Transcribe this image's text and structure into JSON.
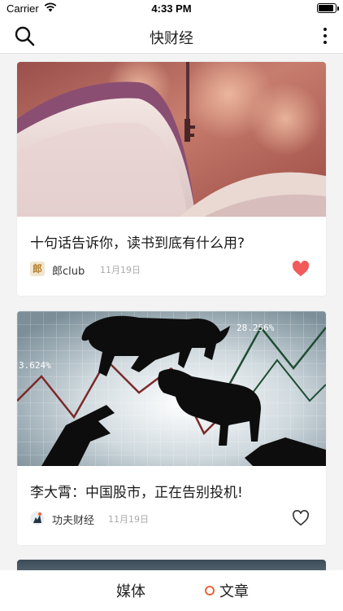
{
  "status_bar": {
    "carrier": "Carrier",
    "time": "4:33 PM"
  },
  "nav": {
    "title": "快财经"
  },
  "articles": [
    {
      "title": "十句话告诉你，读书到底有什么用?",
      "source": "郎club",
      "avatar_text": "郎",
      "date": "11月19日",
      "liked": true
    },
    {
      "title": "李大霄：中国股市，正在告别投机!",
      "source": "功夫财经",
      "date": "11月19日",
      "liked": false,
      "image_labels": {
        "left": "3.624%",
        "right": "28.256%"
      }
    }
  ],
  "tabs": [
    {
      "label": "媒体",
      "selected": false
    },
    {
      "label": "文章",
      "selected": true
    }
  ],
  "colors": {
    "accent": "#e8663a",
    "like_red": "#f25b5b"
  }
}
